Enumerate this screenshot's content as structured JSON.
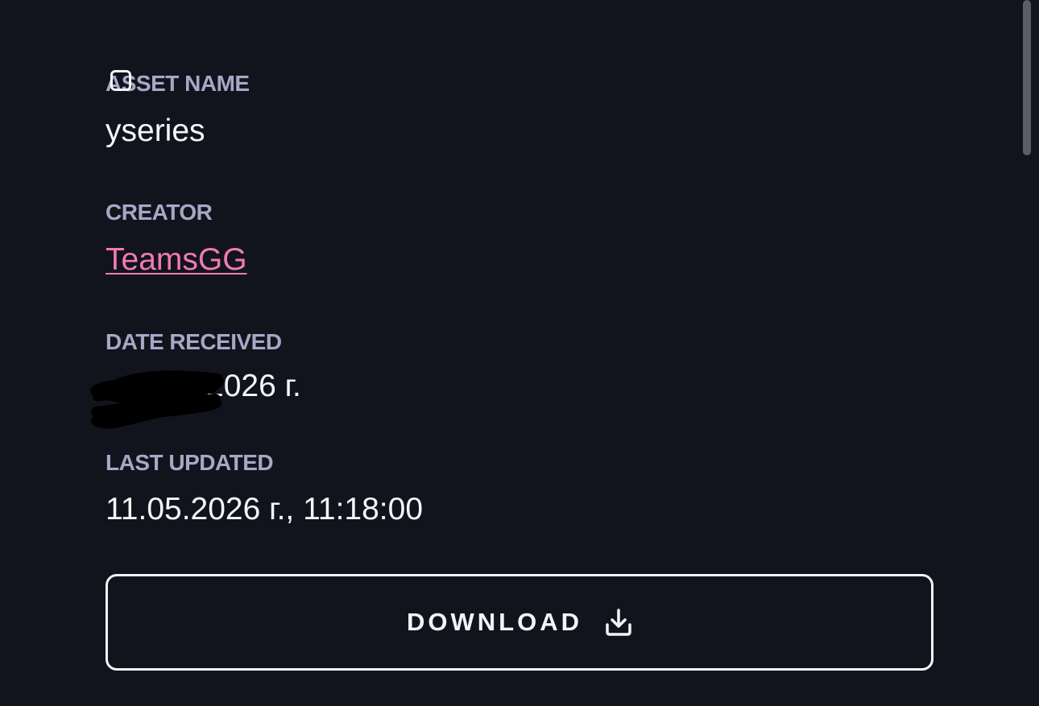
{
  "fields": {
    "asset_name": {
      "label": "ASSET NAME",
      "value": "yseries"
    },
    "creator": {
      "label": "CREATOR",
      "value": "TeamsGG"
    },
    "date_received": {
      "label": "DATE RECEIVED",
      "value": "2026 г."
    },
    "last_updated": {
      "label": "LAST UPDATED",
      "value": "11.05.2026 г., 11:18:00"
    }
  },
  "download": {
    "label": "DOWNLOAD",
    "icon": "download-icon"
  },
  "colors": {
    "background": "#12141d",
    "label": "#a6a8c6",
    "value": "#f6f6f8",
    "link": "#f07ab5",
    "button_border": "#f4f4f6"
  }
}
